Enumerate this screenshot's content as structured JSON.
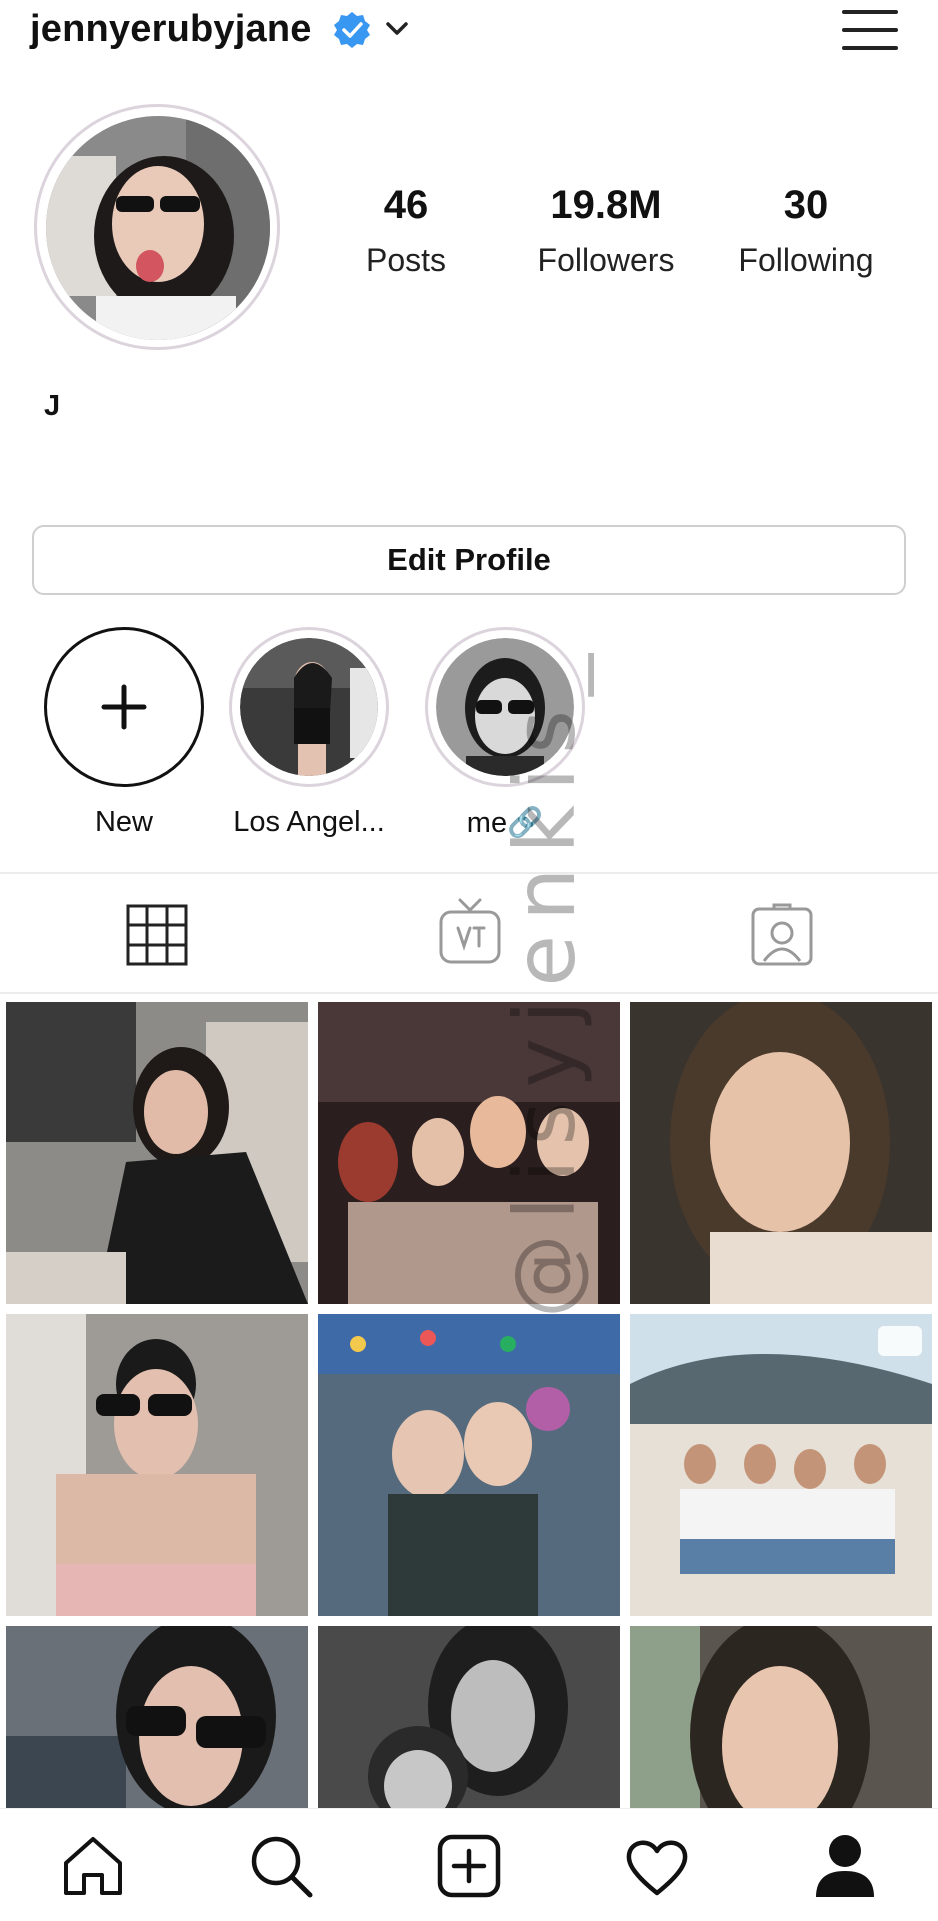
{
  "header": {
    "username": "jennyerubyjane",
    "verified_icon": "verified-badge-icon",
    "dropdown_icon": "chevron-down-icon",
    "menu_icon": "hamburger-menu-icon"
  },
  "stats": [
    {
      "value": "46",
      "label": "Posts"
    },
    {
      "value": "19.8M",
      "label": "Followers"
    },
    {
      "value": "30",
      "label": "Following"
    }
  ],
  "bio": {
    "name": "J"
  },
  "edit_profile_label": "Edit Profile",
  "highlights": [
    {
      "label": "New",
      "icon": "plus-icon"
    },
    {
      "label": "Los Angel...",
      "icon": "highlight-photo"
    },
    {
      "label": "me🔗",
      "icon": "highlight-photo"
    }
  ],
  "tabs": [
    {
      "icon": "grid-icon",
      "selected": true
    },
    {
      "icon": "igtv-icon",
      "selected": false
    },
    {
      "icon": "tagged-icon",
      "selected": false
    }
  ],
  "watermark": "@lisyjenkis_",
  "bottom_nav": [
    "home-icon",
    "search-icon",
    "new-post-icon",
    "heart-icon",
    "profile-icon"
  ],
  "colors": {
    "verified": "#3897f0",
    "ring": "#dcd4dc",
    "border": "#cfcfcf"
  }
}
